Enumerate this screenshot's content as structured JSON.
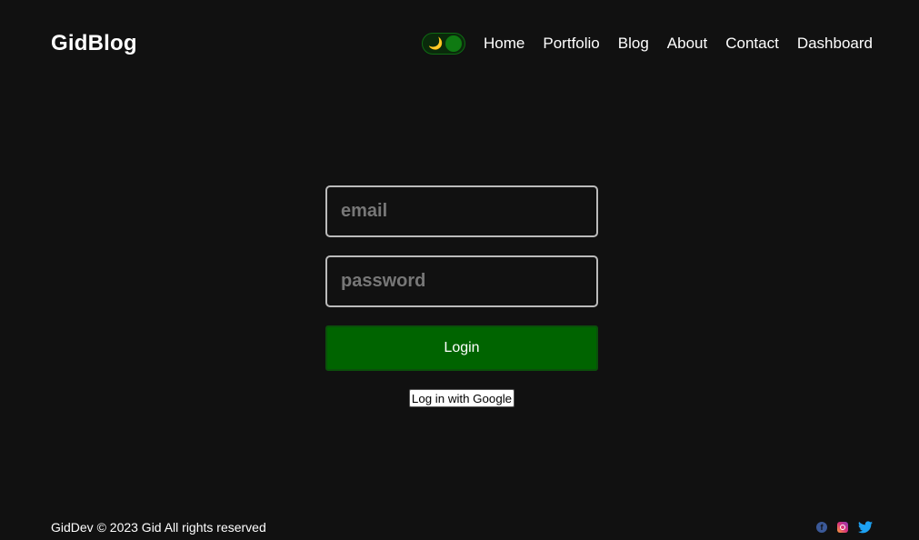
{
  "header": {
    "logo": "GidBlog",
    "theme_toggle": {
      "icon": "moon-icon",
      "glyph": "🌙",
      "state": "dark"
    },
    "nav": [
      {
        "label": "Home"
      },
      {
        "label": "Portfolio"
      },
      {
        "label": "Blog"
      },
      {
        "label": "About"
      },
      {
        "label": "Contact"
      },
      {
        "label": "Dashboard"
      }
    ]
  },
  "form": {
    "email_placeholder": "email",
    "email_value": "",
    "password_placeholder": "password",
    "password_value": "",
    "login_label": "Login",
    "google_label": "Log in with Google"
  },
  "footer": {
    "copyright": "GidDev © 2023 Gid All rights reserved",
    "social": [
      "facebook-icon",
      "instagram-icon",
      "twitter-icon"
    ]
  },
  "colors": {
    "background": "#111111",
    "accent": "#006400",
    "text": "#ffffff",
    "input_border": "#bbbbbb",
    "placeholder": "#777777"
  }
}
